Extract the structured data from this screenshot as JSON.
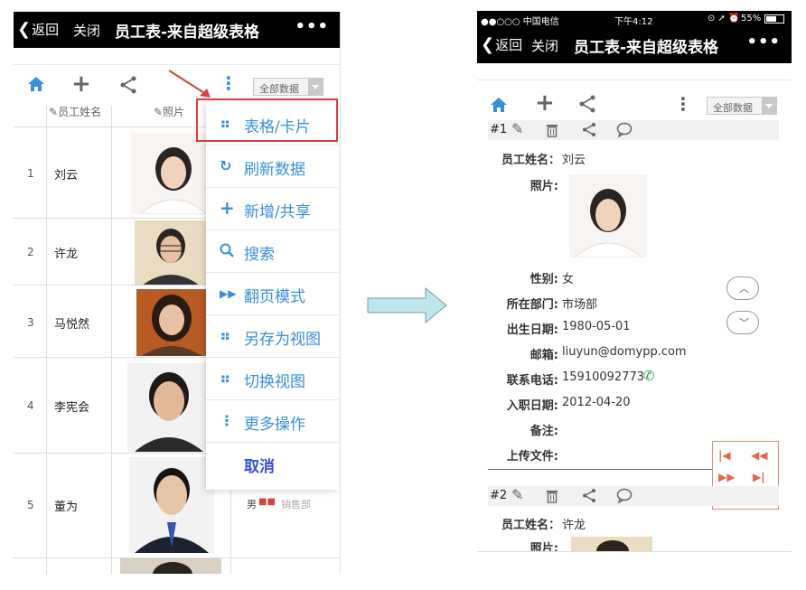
{
  "left_phone": {
    "nav": {
      "back_label": "返回",
      "close_label": "关闭",
      "title": "员工表-来自超级表格",
      "more_label": "•••"
    },
    "toolbar": {
      "view_select": "全部数据"
    },
    "table": {
      "headers": [
        "员工姓名",
        "照片"
      ],
      "rows": [
        {
          "num": "1",
          "name": "刘云"
        },
        {
          "num": "2",
          "name": "许龙"
        },
        {
          "num": "3",
          "name": "马悦然"
        },
        {
          "num": "4",
          "name": "李宪会"
        },
        {
          "num": "5",
          "name": "董为",
          "gender": "男",
          "dept": "销售部"
        }
      ]
    },
    "menu": {
      "items": [
        {
          "icon": "grid-icon",
          "label": "表格/卡片"
        },
        {
          "icon": "refresh-icon",
          "label": "刷新数据"
        },
        {
          "icon": "plus-icon",
          "label": "新增/共享"
        },
        {
          "icon": "search-icon",
          "label": "搜索"
        },
        {
          "icon": "fast-forward-icon",
          "label": "翻页模式"
        },
        {
          "icon": "grid-icon",
          "label": "另存为视图"
        },
        {
          "icon": "grid-icon",
          "label": "切换视图"
        },
        {
          "icon": "vertical-dots-icon",
          "label": "更多操作"
        }
      ],
      "cancel_label": "取消"
    }
  },
  "right_phone": {
    "status": {
      "carrier": "●●○○○ 中国电信",
      "time": "下午4:12",
      "battery": "55%"
    },
    "nav": {
      "back_label": "返回",
      "close_label": "关闭",
      "title": "员工表-来自超级表格",
      "more_label": "•••"
    },
    "toolbar": {
      "view_select": "全部数据"
    },
    "card1": {
      "index": "#1",
      "fields": [
        {
          "label": "员工姓名：",
          "value": "刘云"
        },
        {
          "label": "照片:",
          "value": ""
        },
        {
          "label": "性别:",
          "value": "女"
        },
        {
          "label": "所在部门:",
          "value": "市场部"
        },
        {
          "label": "出生日期:",
          "value": "1980-05-01"
        },
        {
          "label": "邮箱:",
          "value": "liuyun@domypp.com"
        },
        {
          "label": "联系电话:",
          "value": "15910092773"
        },
        {
          "label": "入职日期:",
          "value": "2012-04-20"
        },
        {
          "label": "备注:",
          "value": ""
        },
        {
          "label": "上传文件:",
          "value": ""
        }
      ]
    },
    "card2": {
      "index": "#2",
      "fields": [
        {
          "label": "员工姓名：",
          "value": "许龙"
        },
        {
          "label": "照片:",
          "value": ""
        }
      ]
    }
  },
  "colors": {
    "accent": "#3a8fd8",
    "highlight": "#d64040",
    "pager": "#e06a50",
    "arrow": "#bfe6ec"
  }
}
